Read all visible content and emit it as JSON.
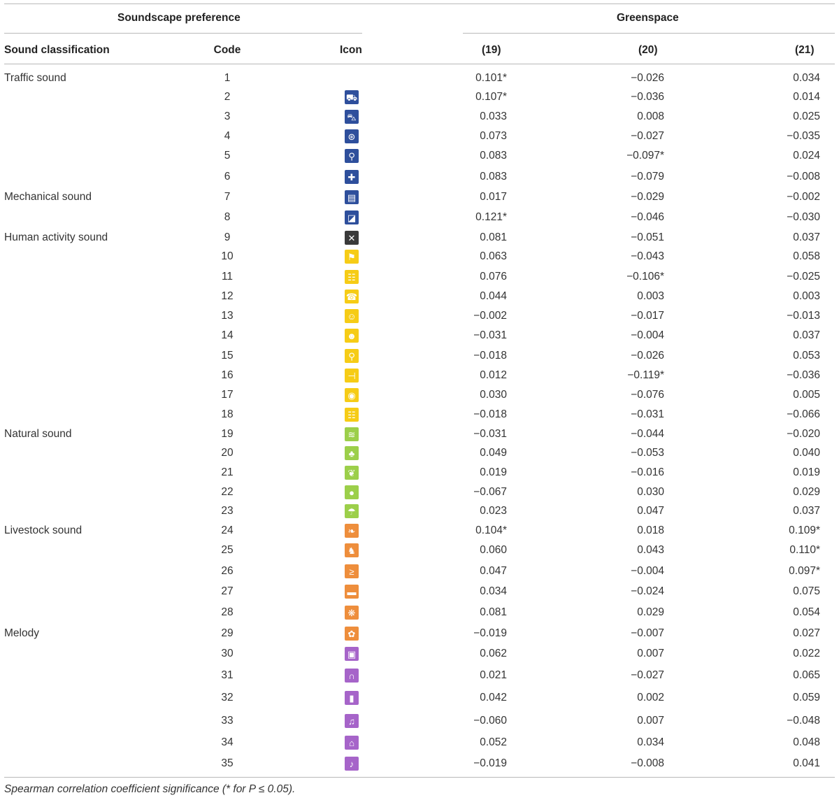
{
  "header": {
    "group_left": "Soundscape preference",
    "group_right": "Greenspace",
    "col_class": "Sound classification",
    "col_code": "Code",
    "col_icon": "Icon",
    "col_19": "(19)",
    "col_20": "(20)",
    "col_21": "(21)"
  },
  "colors": {
    "traffic": "#2e4f9c",
    "mechanical": "#2e4f9c",
    "human": "#f6cc16",
    "natural": "#9ccf4a",
    "livestock": "#ee8e3c",
    "melody": "#a664c9",
    "tools": "#3a3a3a"
  },
  "rows": [
    {
      "class": "Traffic sound",
      "code": "1",
      "icon": "none",
      "v19": "0.101*",
      "v20": "−0.026",
      "v21": "0.034"
    },
    {
      "class": "",
      "code": "2",
      "icon": "tractor-icon",
      "v19": "0.107*",
      "v20": "−0.036",
      "v21": "0.014"
    },
    {
      "class": "",
      "code": "3",
      "icon": "car-icon",
      "v19": "0.033",
      "v20": "0.008",
      "v21": "0.025"
    },
    {
      "class": "",
      "code": "4",
      "icon": "wheel-icon",
      "v19": "0.073",
      "v20": "−0.027",
      "v21": "−0.035"
    },
    {
      "class": "",
      "code": "5",
      "icon": "cyclist-icon",
      "v19": "0.083",
      "v20": "−0.097*",
      "v21": "0.024"
    },
    {
      "class": "",
      "code": "6",
      "icon": "ambulance-icon",
      "v19": "0.083",
      "v20": "−0.079",
      "v21": "−0.008"
    },
    {
      "class": "Mechanical sound",
      "code": "7",
      "icon": "machine-icon",
      "v19": "0.017",
      "v20": "−0.029",
      "v21": "−0.002"
    },
    {
      "class": "",
      "code": "8",
      "icon": "excavator-icon",
      "v19": "0.121*",
      "v20": "−0.046",
      "v21": "−0.030"
    },
    {
      "class": "Human activity sound",
      "code": "9",
      "icon": "tools-icon",
      "v19": "0.081",
      "v20": "−0.051",
      "v21": "0.037"
    },
    {
      "class": "",
      "code": "10",
      "icon": "running-person-icon",
      "v19": "0.063",
      "v20": "−0.043",
      "v21": "0.058"
    },
    {
      "class": "",
      "code": "11",
      "icon": "crowd-icon",
      "v19": "0.076",
      "v20": "−0.106*",
      "v21": "−0.025"
    },
    {
      "class": "",
      "code": "12",
      "icon": "phone-icon",
      "v19": "0.044",
      "v20": "0.003",
      "v21": "0.003"
    },
    {
      "class": "",
      "code": "13",
      "icon": "child-icon",
      "v19": "−0.002",
      "v20": "−0.017",
      "v21": "−0.013"
    },
    {
      "class": "",
      "code": "14",
      "icon": "baby-icon",
      "v19": "−0.031",
      "v20": "−0.004",
      "v21": "0.037"
    },
    {
      "class": "",
      "code": "15",
      "icon": "walking-person-icon",
      "v19": "−0.018",
      "v20": "−0.026",
      "v21": "0.053"
    },
    {
      "class": "",
      "code": "16",
      "icon": "hammer-icon",
      "v19": "0.012",
      "v20": "−0.119*",
      "v21": "−0.036"
    },
    {
      "class": "",
      "code": "17",
      "icon": "footsteps-icon",
      "v19": "0.030",
      "v20": "−0.076",
      "v21": "0.005"
    },
    {
      "class": "",
      "code": "18",
      "icon": "group-icon",
      "v19": "−0.018",
      "v20": "−0.031",
      "v21": "−0.066"
    },
    {
      "class": "Natural sound",
      "code": "19",
      "icon": "wind-icon",
      "v19": "−0.031",
      "v20": "−0.044",
      "v21": "−0.020"
    },
    {
      "class": "",
      "code": "20",
      "icon": "tree-icon",
      "v19": "0.049",
      "v20": "−0.053",
      "v21": "0.040"
    },
    {
      "class": "",
      "code": "21",
      "icon": "leaf-icon",
      "v19": "0.019",
      "v20": "−0.016",
      "v21": "0.019"
    },
    {
      "class": "",
      "code": "22",
      "icon": "water-drop-icon",
      "v19": "−0.067",
      "v20": "0.030",
      "v21": "0.029"
    },
    {
      "class": "",
      "code": "23",
      "icon": "rain-icon",
      "v19": "0.023",
      "v20": "0.047",
      "v21": "0.037"
    },
    {
      "class": "Livestock sound",
      "code": "24",
      "icon": "bird-icon",
      "v19": "0.104*",
      "v20": "0.018",
      "v21": "0.109*"
    },
    {
      "class": "",
      "code": "25",
      "icon": "rooster-icon",
      "v19": "0.060",
      "v20": "0.043",
      "v21": "0.110*"
    },
    {
      "class": "",
      "code": "26",
      "icon": "duck-icon",
      "v19": "0.047",
      "v20": "−0.004",
      "v21": "0.097*"
    },
    {
      "class": "",
      "code": "27",
      "icon": "pig-icon",
      "v19": "0.034",
      "v20": "−0.024",
      "v21": "0.075"
    },
    {
      "class": "",
      "code": "28",
      "icon": "insect-icon",
      "v19": "0.081",
      "v20": "0.029",
      "v21": "0.054"
    },
    {
      "class": "Melody",
      "code": "29",
      "icon": "frog-icon",
      "v19": "−0.019",
      "v20": "−0.007",
      "v21": "0.027"
    },
    {
      "class": "",
      "code": "30",
      "icon": "speaker-icon",
      "v19": "0.062",
      "v20": "0.007",
      "v21": "0.022"
    },
    {
      "class": "",
      "code": "31",
      "icon": "headphones-icon",
      "v19": "0.021",
      "v20": "−0.027",
      "v21": "0.065"
    },
    {
      "class": "",
      "code": "32",
      "icon": "microphone-icon",
      "v19": "0.042",
      "v20": "0.002",
      "v21": "0.059"
    },
    {
      "class": "",
      "code": "33",
      "icon": "dancing-icon",
      "v19": "−0.060",
      "v20": "0.007",
      "v21": "−0.048"
    },
    {
      "class": "",
      "code": "34",
      "icon": "bell-icon",
      "v19": "0.052",
      "v20": "0.034",
      "v21": "0.048"
    },
    {
      "class": "",
      "code": "35",
      "icon": "flute-icon",
      "v19": "−0.019",
      "v20": "−0.008",
      "v21": "0.041"
    }
  ],
  "footnote": "Spearman correlation coefficient significance (* for P ≤ 0.05)."
}
